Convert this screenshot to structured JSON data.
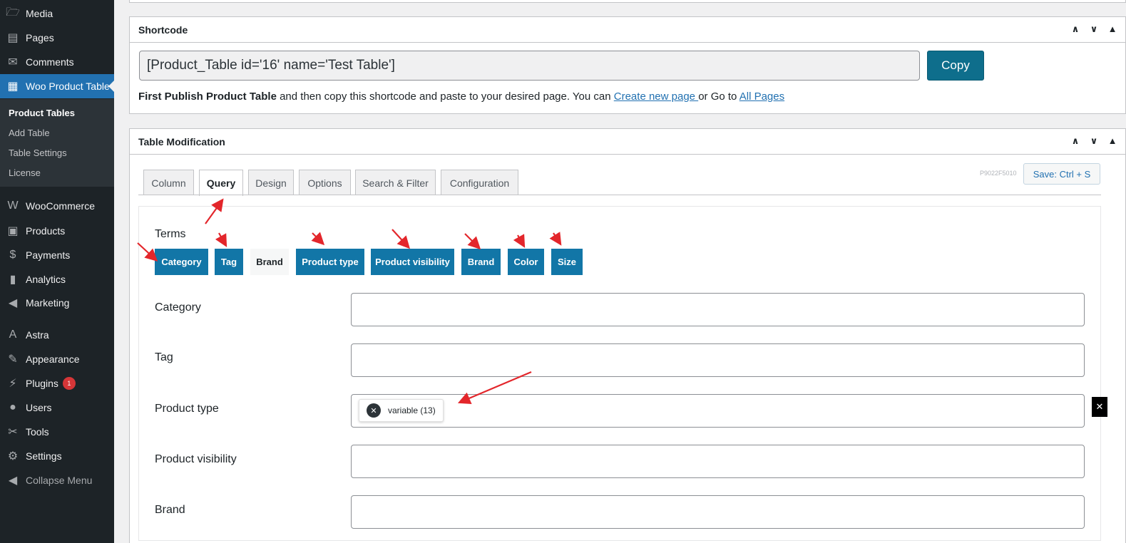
{
  "sidebar": {
    "items": [
      {
        "label": "Media",
        "icon": "media-icon",
        "glyph": "🗁"
      },
      {
        "label": "Pages",
        "icon": "pages-icon",
        "glyph": "▤"
      },
      {
        "label": "Comments",
        "icon": "comments-icon",
        "glyph": "✉"
      },
      {
        "label": "Woo Product Table",
        "icon": "table-icon",
        "glyph": "▦"
      },
      {
        "label": "WooCommerce",
        "icon": "woocommerce-icon",
        "glyph": "W"
      },
      {
        "label": "Products",
        "icon": "archive-icon",
        "glyph": "▣"
      },
      {
        "label": "Payments",
        "icon": "payments-icon",
        "glyph": "$"
      },
      {
        "label": "Analytics",
        "icon": "analytics-icon",
        "glyph": "▮"
      },
      {
        "label": "Marketing",
        "icon": "megaphone-icon",
        "glyph": "◀"
      },
      {
        "label": "Astra",
        "icon": "astra-icon",
        "glyph": "A"
      },
      {
        "label": "Appearance",
        "icon": "paintbrush-icon",
        "glyph": "✎"
      },
      {
        "label": "Plugins",
        "icon": "plugins-icon",
        "glyph": "⚡"
      },
      {
        "label": "Users",
        "icon": "users-icon",
        "glyph": "●"
      },
      {
        "label": "Tools",
        "icon": "tools-icon",
        "glyph": "✂"
      },
      {
        "label": "Settings",
        "icon": "settings-icon",
        "glyph": "⚙"
      },
      {
        "label": "Collapse Menu",
        "icon": "collapse-icon",
        "glyph": "◀"
      }
    ],
    "plugins_badge": "1",
    "submenu": [
      "Product Tables",
      "Add Table",
      "Table Settings",
      "License"
    ]
  },
  "shortcode_panel": {
    "title": "Shortcode",
    "shortcode": "[Product_Table id='16' name='Test Table']",
    "copy_label": "Copy",
    "help_bold": "First Publish Product Table",
    "help_text": " and then copy this shortcode and paste to your desired page. You can ",
    "create_link": "Create new page ",
    "or_text": "or Go to ",
    "all_pages_link": "All Pages"
  },
  "panel_controls": {
    "up": "∧",
    "down": "∨",
    "toggle": "▲"
  },
  "modification_panel": {
    "title": "Table Modification",
    "tabs": [
      "Column",
      "Query",
      "Design",
      "Options",
      "Search & Filter",
      "Configuration"
    ],
    "active_tab": "Query",
    "version": "P9022F5010",
    "save_label": "Save: Ctrl + S",
    "terms_label": "Terms",
    "term_buttons": [
      {
        "label": "Category",
        "active": true
      },
      {
        "label": "Tag",
        "active": true
      },
      {
        "label": "Brand",
        "active": false
      },
      {
        "label": "Product type",
        "active": true
      },
      {
        "label": "Product visibility",
        "active": true
      },
      {
        "label": "Brand",
        "active": true
      },
      {
        "label": "Color",
        "active": true
      },
      {
        "label": "Size",
        "active": true
      }
    ],
    "fields": [
      {
        "label": "Category",
        "value": ""
      },
      {
        "label": "Tag",
        "value": ""
      },
      {
        "label": "Product type",
        "value": "variable (13)"
      },
      {
        "label": "Product visibility",
        "value": ""
      },
      {
        "label": "Brand",
        "value": ""
      }
    ],
    "chip_remove": "✕",
    "clear_x": "✕"
  },
  "colors": {
    "sidebar": "#1d2327",
    "active_menu": "#2271b1",
    "term_button": "#1276a7",
    "arrow": "#e3262b"
  }
}
